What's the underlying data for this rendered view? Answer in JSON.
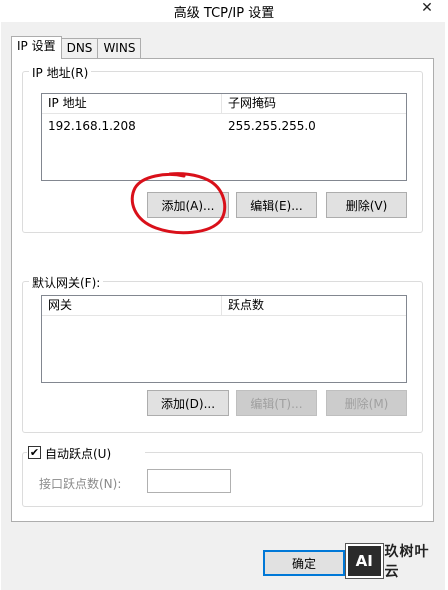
{
  "window": {
    "title": "高级 TCP/IP 设置",
    "close_glyph": "✕"
  },
  "tabs": [
    {
      "label": "IP 设置",
      "active": true
    },
    {
      "label": "DNS",
      "active": false
    },
    {
      "label": "WINS",
      "active": false
    }
  ],
  "ip_group": {
    "legend": "IP 地址(R)",
    "columns": [
      "IP 地址",
      "子网掩码"
    ],
    "rows": [
      {
        "ip": "192.168.1.208",
        "mask": "255.255.255.0"
      }
    ],
    "add_label": "添加(A)...",
    "edit_label": "编辑(E)...",
    "delete_label": "删除(V)"
  },
  "gateway_group": {
    "legend": "默认网关(F):",
    "columns": [
      "网关",
      "跃点数"
    ],
    "add_label": "添加(D)...",
    "edit_label": "编辑(T)...",
    "delete_label": "删除(M)"
  },
  "metric_group": {
    "auto_metric_label": "自动跃点(U)",
    "auto_metric_checked": true,
    "interface_metric_label": "接口跃点数(N):",
    "interface_metric_value": ""
  },
  "footer": {
    "ok_label": "确定"
  },
  "watermark": {
    "logo_text": "AI",
    "text": "玖树叶云"
  },
  "colors": {
    "annotation": "#d9101a",
    "accent": "#0078d7"
  }
}
